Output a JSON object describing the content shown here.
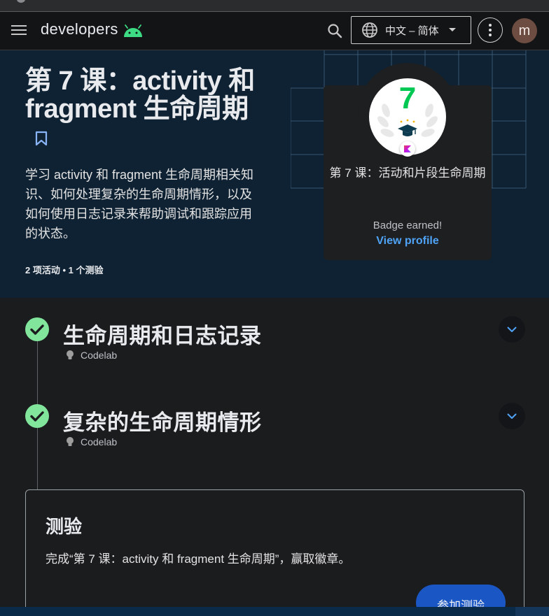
{
  "nav": {
    "brand": "developers",
    "language": "中文 – 简体",
    "avatar_initial": "m"
  },
  "hero": {
    "title": "第 7 课：activity 和 fragment 生命周期",
    "description": "学习 activity 和 fragment 生命周期相关知识、如何处理复杂的生命周期情形，以及如何使用日志记录来帮助调试和跟踪应用的状态。",
    "meta": "2 项活动 • 1 个测验"
  },
  "badge": {
    "number": "7",
    "title": "第 7 课：活动和片段生命周期",
    "earned": "Badge earned!",
    "link": "View profile"
  },
  "activities": [
    {
      "title": "生命周期和日志记录",
      "type": "Codelab",
      "completed": true
    },
    {
      "title": "复杂的生命周期情形",
      "type": "Codelab",
      "completed": true
    }
  ],
  "quiz": {
    "title": "测验",
    "description": "完成“第 7 课：activity 和 fragment 生命周期”，赢取徽章。",
    "button": "参加测验"
  },
  "colors": {
    "hero_bg": "#0f2233",
    "page_bg": "#1b1c1e",
    "accent_blue": "#4fa3f7",
    "check_green": "#81e59c",
    "button_blue": "#1a56c4"
  }
}
